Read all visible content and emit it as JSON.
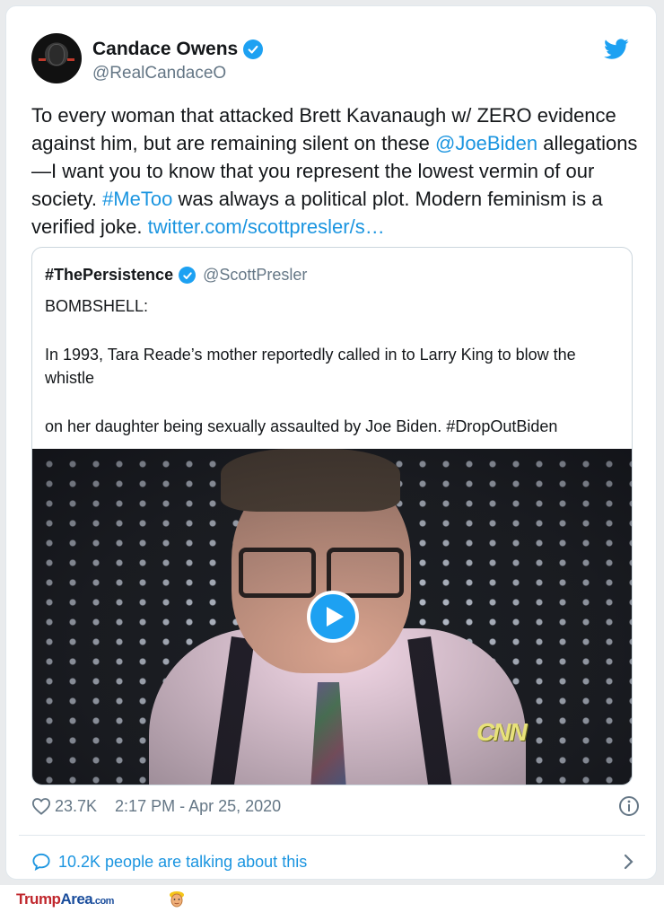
{
  "tweet": {
    "author_name": "Candace Owens",
    "author_handle": "@RealCandaceO",
    "text_parts": {
      "p1": "To every woman that attacked Brett Kavanaugh w/ ZERO evidence against him, but are remaining silent  on these ",
      "mention": "@JoeBiden",
      "p2": " allegations —I want you to know that you represent the lowest vermin of our society. ",
      "hashtag": "#MeToo",
      "p3": " was always a political plot. Modern feminism is a verified joke. ",
      "link": "twitter.com/scottpresler/s…"
    },
    "likes": "23.7K",
    "timestamp": "2:17 PM - Apr 25, 2020",
    "talking": "10.2K people are talking about this"
  },
  "quoted": {
    "name": "#ThePersistence",
    "handle": "@ScottPresler",
    "lines": [
      "BOMBSHELL:",
      "In 1993, Tara Reade’s mother reportedly called in to Larry King to blow the whistle",
      "on her daughter being sexually assaulted by Joe Biden. #DropOutBiden"
    ],
    "video_watermark": "CNN"
  },
  "footer": {
    "brand_part1": "Trump",
    "brand_part2": "Area",
    "brand_part3": ".com"
  },
  "colors": {
    "accent": "#1da1f2",
    "link": "#1b95e0",
    "muted": "#657786",
    "brand_red": "#c0272d",
    "brand_blue": "#1a4d9c"
  },
  "icons": [
    "verified-badge-icon",
    "twitter-bird-icon",
    "play-icon",
    "heart-icon",
    "info-icon",
    "comment-bubble-icon",
    "chevron-right-icon",
    "trump-face-icon"
  ]
}
